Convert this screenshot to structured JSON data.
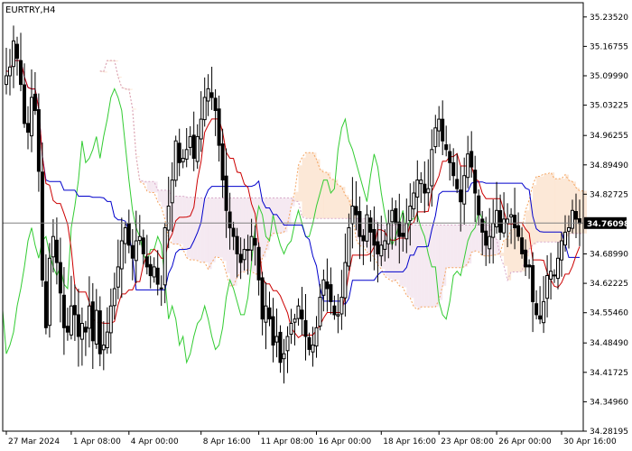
{
  "symbol_label": "EURTRY,H4",
  "colors": {
    "background": "#ffffff",
    "frame": "#000000",
    "candle": "#000000",
    "tenkan": "#cc0000",
    "kijun": "#0000cc",
    "chikou": "#33cc33",
    "cloud_bull": "#f4a460",
    "cloud_bear": "#d8a8c8",
    "price_line": "#808080",
    "price_box": "#000000",
    "price_text": "#ffffff"
  },
  "chart_data": {
    "type": "candlestick",
    "title": "EURTRY,H4",
    "indicator": "Ichimoku Kinko Hyo",
    "current_price": "34.76098",
    "current_price_value": 34.76098,
    "ylim": [
      34.2819,
      35.2681
    ],
    "y_ticks": [
      "35.23520",
      "35.16755",
      "35.09990",
      "35.03225",
      "34.96255",
      "34.89490",
      "34.82725",
      "34.76098",
      "34.68990",
      "34.62225",
      "34.55460",
      "34.48490",
      "34.41725",
      "34.34960",
      "34.28195"
    ],
    "y_tick_values": [
      35.2352,
      35.16755,
      35.0999,
      35.03225,
      34.96255,
      34.8949,
      34.82725,
      34.76098,
      34.6899,
      34.62225,
      34.5546,
      34.4849,
      34.41725,
      34.3496,
      34.28195
    ],
    "x_ticks": [
      "27 Mar 2024",
      "1 Apr 08:00",
      "4 Apr 00:00",
      "8 Apr 16:00",
      "11 Apr 08:00",
      "16 Apr 00:00",
      "18 Apr 16:00",
      "23 Apr 08:00",
      "26 Apr 00:00",
      "30 Apr 16:00"
    ],
    "x_tick_bar_index": [
      0,
      18,
      34,
      54,
      70,
      86,
      104,
      120,
      136,
      154
    ],
    "bar_count": 160,
    "closes": [
      35.1,
      35.12,
      35.18,
      35.14,
      35.08,
      34.99,
      34.97,
      35.05,
      35.02,
      34.88,
      34.63,
      34.52,
      34.68,
      34.73,
      34.67,
      34.6,
      34.52,
      34.51,
      34.57,
      34.55,
      34.5,
      34.53,
      34.51,
      34.57,
      34.49,
      34.56,
      34.46,
      34.48,
      34.51,
      34.57,
      34.61,
      34.66,
      34.72,
      34.75,
      34.71,
      34.68,
      34.72,
      34.73,
      34.69,
      34.66,
      34.64,
      34.66,
      34.62,
      34.61,
      34.75,
      34.8,
      34.86,
      34.95,
      34.9,
      34.91,
      34.93,
      34.96,
      34.91,
      34.96,
      35.0,
      35.05,
      35.07,
      35.05,
      35.02,
      34.94,
      34.86,
      34.79,
      34.75,
      34.73,
      34.69,
      34.67,
      34.7,
      34.7,
      34.73,
      34.71,
      34.63,
      34.54,
      34.57,
      34.54,
      34.48,
      34.5,
      34.44,
      34.46,
      34.5,
      34.53,
      34.54,
      34.57,
      34.54,
      34.5,
      34.47,
      34.48,
      34.52,
      34.59,
      34.63,
      34.61,
      34.58,
      34.55,
      34.55,
      34.59,
      34.67,
      34.75,
      34.8,
      34.78,
      34.73,
      34.72,
      34.78,
      34.74,
      34.71,
      34.69,
      34.71,
      34.72,
      34.76,
      34.79,
      34.76,
      34.73,
      34.73,
      34.76,
      34.8,
      34.83,
      34.86,
      34.86,
      34.83,
      34.84,
      34.93,
      34.98,
      35.0,
      34.95,
      34.93,
      34.9,
      34.87,
      34.84,
      34.81,
      34.87,
      34.92,
      34.89,
      34.83,
      34.78,
      34.74,
      34.71,
      34.73,
      34.76,
      34.79,
      34.74,
      34.77,
      34.77,
      34.78,
      34.75,
      34.73,
      34.69,
      34.66,
      34.66,
      34.58,
      34.55,
      34.54,
      34.58,
      34.64,
      34.65,
      34.64,
      34.68,
      34.72,
      34.74,
      34.75,
      34.79,
      34.77,
      34.76
    ]
  }
}
